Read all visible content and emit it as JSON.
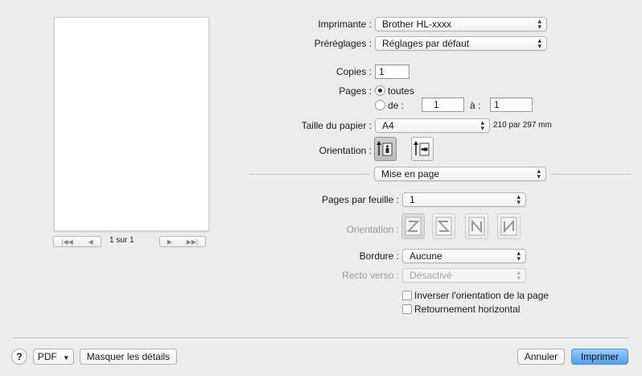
{
  "printer": {
    "label": "Imprimante :",
    "value": "Brother HL-xxxx"
  },
  "presets": {
    "label": "Préréglages :",
    "value": "Réglages par défaut"
  },
  "copies": {
    "label": "Copies :",
    "value": "1"
  },
  "pages": {
    "label": "Pages :",
    "all_label": "toutes",
    "range_label": "de :",
    "from": "1",
    "to_label": "à :",
    "to": "1"
  },
  "paper": {
    "label": "Taille du papier :",
    "value": "A4",
    "dimensions": "210 par 297 mm"
  },
  "orientation": {
    "label": "Orientation :"
  },
  "section": {
    "value": "Mise en page"
  },
  "pages_per_sheet": {
    "label": "Pages par feuille :",
    "value": "1"
  },
  "layout_direction": {
    "label": "Orientation :"
  },
  "border": {
    "label": "Bordure :",
    "value": "Aucune"
  },
  "duplex": {
    "label": "Recto verso :",
    "value": "Désactivé"
  },
  "checkboxes": {
    "reverse_orientation": "Inverser l'orientation de la page",
    "flip_horizontal": "Retournement horizontal"
  },
  "preview": {
    "page_count": "1 sur 1"
  },
  "footer": {
    "help": "?",
    "pdf": "PDF",
    "details": "Masquer les détails",
    "cancel": "Annuler",
    "print": "Imprimer"
  },
  "colors": {
    "accent": "#4c9ff0",
    "background": "#ececec"
  }
}
